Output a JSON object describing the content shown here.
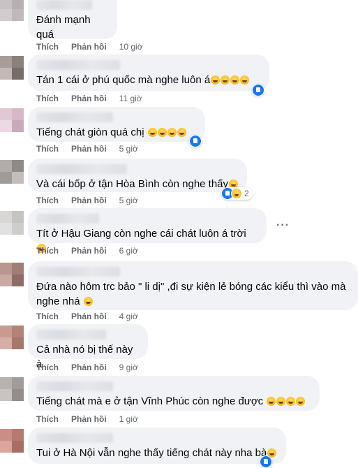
{
  "actions": {
    "like": "Thích",
    "reply": "Phản hồi"
  },
  "comments": [
    {
      "text": "Đánh mạnh quá",
      "time": "10 giờ",
      "emojis": 0
    },
    {
      "text": "Tán 1 cái ở phú quốc mà nghe luôn á",
      "time": "11 giờ",
      "emojis": 4
    },
    {
      "text": "Tiếng chát giòn quá chị",
      "time": "5 giờ",
      "emojis": 4
    },
    {
      "text": "Và cái bốp ở tận Hòa Bình còn nghe thấy",
      "time": "5 giờ",
      "emojis": 1,
      "reaction_count": "2"
    },
    {
      "text": "Tít ở Hậu Giang còn nghe cái chát luôn á trời",
      "time": "6 giờ",
      "emojis": 1,
      "more_icon": "···"
    },
    {
      "text_line1": "Đứa nào hôm trc bảo \" li dị\" ,đi sự kiện lẻ bóng các kiểu thì vào mà",
      "text_line2": "nghe nhá",
      "time": "4 giờ",
      "emojis": 1
    },
    {
      "text": "Cả nhà nó bị thế này à",
      "time": "9 giờ",
      "emojis": 0
    },
    {
      "text": "Tiếng chát mà e ở tận Vĩnh Phúc còn nghe được",
      "time": "1 giờ",
      "emojis": 4
    },
    {
      "text": "Tui ở Hà Nội vẫn nghe thấy tiếng chát này nha bà",
      "emojis": 1
    }
  ],
  "icons": {
    "like": "like-icon",
    "haha": "haha-icon",
    "more": "more-options-icon"
  }
}
